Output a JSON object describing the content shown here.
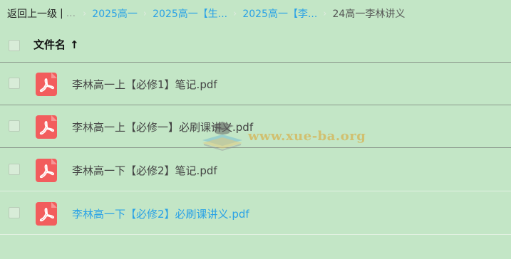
{
  "breadcrumb": {
    "back_label": "返回上一级",
    "separator": "|",
    "ellipsis": "...",
    "arrow": "›",
    "items": [
      {
        "label": "2025高一"
      },
      {
        "label": "2025高一【生..."
      },
      {
        "label": "2025高一【李..."
      }
    ],
    "current": "24高一李林讲义"
  },
  "header": {
    "filename_label": "文件名",
    "sort_icon": "arrow-up-icon",
    "sort_glyph": "↑"
  },
  "files": [
    {
      "name": "李林高一上【必修1】笔记.pdf",
      "icon": "pdf-icon",
      "hovered": false
    },
    {
      "name": "李林高一上【必修一】必刷课讲义.pdf",
      "icon": "pdf-icon",
      "hovered": false
    },
    {
      "name": "李林高一下【必修2】笔记.pdf",
      "icon": "pdf-icon",
      "hovered": false
    },
    {
      "name": "李林高一下【必修2】必刷课讲义.pdf",
      "icon": "pdf-icon",
      "hovered": true
    }
  ],
  "watermark": {
    "text": "www.xue-ba.org"
  },
  "colors": {
    "background": "#c3e6c6",
    "link": "#2aa2e6",
    "pdf_icon": "#f25d5d"
  }
}
